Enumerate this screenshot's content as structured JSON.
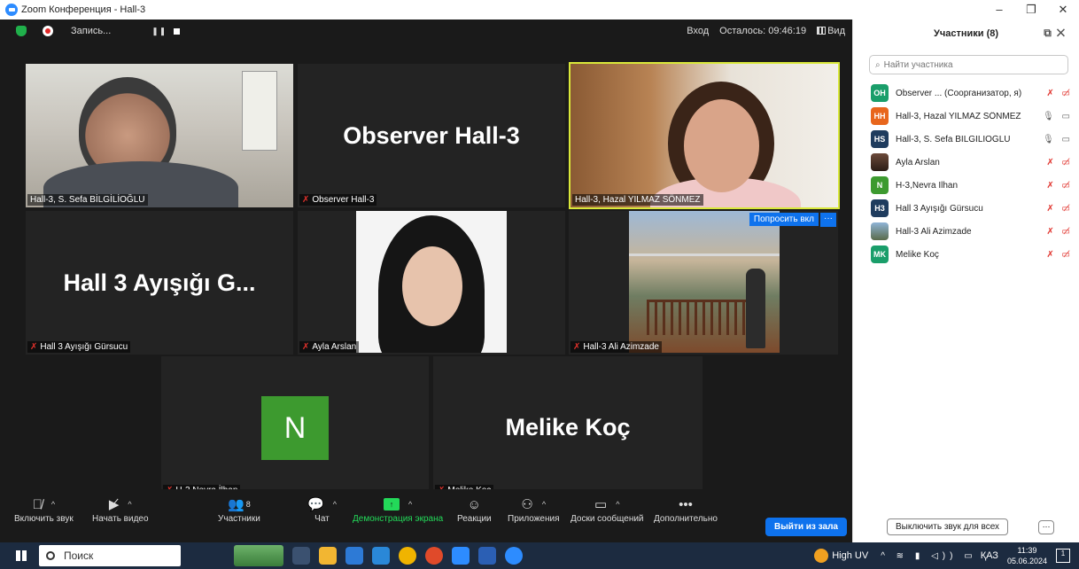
{
  "window": {
    "title": "Zoom Конференция - Hall-3",
    "controls": [
      "–",
      "❐",
      "✕"
    ]
  },
  "topbar": {
    "recording_label": "Запись...",
    "pause_icon": "❚❚",
    "login_label": "Вход",
    "remaining_label": "Осталось: 09:46:19",
    "view_label": "Вид"
  },
  "tiles": [
    {
      "name": "Hall-3, S. Sefa BİLGİLİOĞLU",
      "type": "video",
      "muted": false
    },
    {
      "name": "Observer Hall-3",
      "big": "Observer Hall-3",
      "type": "name",
      "muted": true
    },
    {
      "name": "Hall-3, Hazal YILMAZ SÖNMEZ",
      "type": "video",
      "muted": false,
      "active_speaker": true
    },
    {
      "name": "Hall 3 Ayışığı Gürsucu",
      "big": "Hall 3 Ayışığı G...",
      "type": "name",
      "muted": true
    },
    {
      "name": "Ayla Arslan",
      "type": "video",
      "muted": true
    },
    {
      "name": "Hall-3 Ali Azimzade",
      "type": "video",
      "muted": true,
      "ask_button": "Попросить вкл",
      "more": "···"
    },
    {
      "name": "H-3,Nevra İlhan",
      "avatar_letter": "N",
      "type": "avatar",
      "muted": true
    },
    {
      "name": "Melike Koç",
      "big": "Melike Koç",
      "type": "name",
      "muted": true
    }
  ],
  "toolbar": {
    "unmute": "Включить звук",
    "start_video": "Начать видео",
    "participants": "Участники",
    "participants_count": "8",
    "chat": "Чат",
    "share": "Демонстрация экрана",
    "reactions": "Реакции",
    "apps": "Приложения",
    "whiteboards": "Доски сообщений",
    "more": "Дополнительно",
    "leave": "Выйти из зала"
  },
  "panel": {
    "title": "Участники (8)",
    "search_placeholder": "Найти участника",
    "participants": [
      {
        "initials": "OH",
        "color": "#1a9e6a",
        "name": "Observer ... (Соорганизатор, я)",
        "mic": "muted",
        "cam": "off"
      },
      {
        "initials": "HH",
        "color": "#e8661c",
        "name": "Hall-3, Hazal YILMAZ SÖNMEZ",
        "mic": "on",
        "cam": "on"
      },
      {
        "initials": "HS",
        "color": "#1f3c5e",
        "name": "Hall-3, S. Sefa BİLGİLİOĞLU",
        "mic": "on",
        "cam": "on"
      },
      {
        "initials": "",
        "color": "photo",
        "name": "Ayla Arslan",
        "mic": "muted",
        "cam": "off"
      },
      {
        "initials": "N",
        "color": "#3d9a2f",
        "name": "H-3,Nevra İlhan",
        "mic": "muted",
        "cam": "off"
      },
      {
        "initials": "H3",
        "color": "#1f3c5e",
        "name": "Hall 3 Ayışığı Gürsucu",
        "mic": "muted",
        "cam": "off"
      },
      {
        "initials": "",
        "color": "photo2",
        "name": "Hall-3 Ali Azimzade",
        "mic": "muted",
        "cam": "off"
      },
      {
        "initials": "MK",
        "color": "#1a9e6a",
        "name": "Melike Koç",
        "mic": "muted",
        "cam": "off"
      }
    ],
    "mute_all": "Выключить звук для всех",
    "more": "···"
  },
  "taskbar": {
    "search": "Поиск",
    "weather": "High UV",
    "lang": "ҚАЗ",
    "time": "11:39",
    "date": "05.06.2024",
    "notifications": "1"
  }
}
